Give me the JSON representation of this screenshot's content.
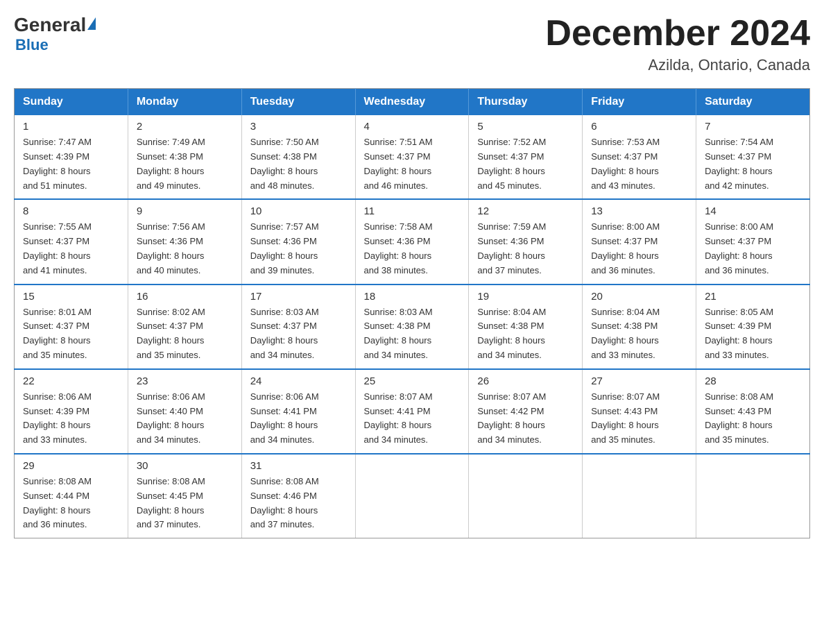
{
  "logo": {
    "general": "General",
    "blue": "Blue",
    "subtitle": "Blue"
  },
  "title": {
    "month_year": "December 2024",
    "location": "Azilda, Ontario, Canada"
  },
  "headers": [
    "Sunday",
    "Monday",
    "Tuesday",
    "Wednesday",
    "Thursday",
    "Friday",
    "Saturday"
  ],
  "weeks": [
    [
      {
        "day": "1",
        "sunrise": "7:47 AM",
        "sunset": "4:39 PM",
        "daylight": "8 hours and 51 minutes."
      },
      {
        "day": "2",
        "sunrise": "7:49 AM",
        "sunset": "4:38 PM",
        "daylight": "8 hours and 49 minutes."
      },
      {
        "day": "3",
        "sunrise": "7:50 AM",
        "sunset": "4:38 PM",
        "daylight": "8 hours and 48 minutes."
      },
      {
        "day": "4",
        "sunrise": "7:51 AM",
        "sunset": "4:37 PM",
        "daylight": "8 hours and 46 minutes."
      },
      {
        "day": "5",
        "sunrise": "7:52 AM",
        "sunset": "4:37 PM",
        "daylight": "8 hours and 45 minutes."
      },
      {
        "day": "6",
        "sunrise": "7:53 AM",
        "sunset": "4:37 PM",
        "daylight": "8 hours and 43 minutes."
      },
      {
        "day": "7",
        "sunrise": "7:54 AM",
        "sunset": "4:37 PM",
        "daylight": "8 hours and 42 minutes."
      }
    ],
    [
      {
        "day": "8",
        "sunrise": "7:55 AM",
        "sunset": "4:37 PM",
        "daylight": "8 hours and 41 minutes."
      },
      {
        "day": "9",
        "sunrise": "7:56 AM",
        "sunset": "4:36 PM",
        "daylight": "8 hours and 40 minutes."
      },
      {
        "day": "10",
        "sunrise": "7:57 AM",
        "sunset": "4:36 PM",
        "daylight": "8 hours and 39 minutes."
      },
      {
        "day": "11",
        "sunrise": "7:58 AM",
        "sunset": "4:36 PM",
        "daylight": "8 hours and 38 minutes."
      },
      {
        "day": "12",
        "sunrise": "7:59 AM",
        "sunset": "4:36 PM",
        "daylight": "8 hours and 37 minutes."
      },
      {
        "day": "13",
        "sunrise": "8:00 AM",
        "sunset": "4:37 PM",
        "daylight": "8 hours and 36 minutes."
      },
      {
        "day": "14",
        "sunrise": "8:00 AM",
        "sunset": "4:37 PM",
        "daylight": "8 hours and 36 minutes."
      }
    ],
    [
      {
        "day": "15",
        "sunrise": "8:01 AM",
        "sunset": "4:37 PM",
        "daylight": "8 hours and 35 minutes."
      },
      {
        "day": "16",
        "sunrise": "8:02 AM",
        "sunset": "4:37 PM",
        "daylight": "8 hours and 35 minutes."
      },
      {
        "day": "17",
        "sunrise": "8:03 AM",
        "sunset": "4:37 PM",
        "daylight": "8 hours and 34 minutes."
      },
      {
        "day": "18",
        "sunrise": "8:03 AM",
        "sunset": "4:38 PM",
        "daylight": "8 hours and 34 minutes."
      },
      {
        "day": "19",
        "sunrise": "8:04 AM",
        "sunset": "4:38 PM",
        "daylight": "8 hours and 34 minutes."
      },
      {
        "day": "20",
        "sunrise": "8:04 AM",
        "sunset": "4:38 PM",
        "daylight": "8 hours and 33 minutes."
      },
      {
        "day": "21",
        "sunrise": "8:05 AM",
        "sunset": "4:39 PM",
        "daylight": "8 hours and 33 minutes."
      }
    ],
    [
      {
        "day": "22",
        "sunrise": "8:06 AM",
        "sunset": "4:39 PM",
        "daylight": "8 hours and 33 minutes."
      },
      {
        "day": "23",
        "sunrise": "8:06 AM",
        "sunset": "4:40 PM",
        "daylight": "8 hours and 34 minutes."
      },
      {
        "day": "24",
        "sunrise": "8:06 AM",
        "sunset": "4:41 PM",
        "daylight": "8 hours and 34 minutes."
      },
      {
        "day": "25",
        "sunrise": "8:07 AM",
        "sunset": "4:41 PM",
        "daylight": "8 hours and 34 minutes."
      },
      {
        "day": "26",
        "sunrise": "8:07 AM",
        "sunset": "4:42 PM",
        "daylight": "8 hours and 34 minutes."
      },
      {
        "day": "27",
        "sunrise": "8:07 AM",
        "sunset": "4:43 PM",
        "daylight": "8 hours and 35 minutes."
      },
      {
        "day": "28",
        "sunrise": "8:08 AM",
        "sunset": "4:43 PM",
        "daylight": "8 hours and 35 minutes."
      }
    ],
    [
      {
        "day": "29",
        "sunrise": "8:08 AM",
        "sunset": "4:44 PM",
        "daylight": "8 hours and 36 minutes."
      },
      {
        "day": "30",
        "sunrise": "8:08 AM",
        "sunset": "4:45 PM",
        "daylight": "8 hours and 37 minutes."
      },
      {
        "day": "31",
        "sunrise": "8:08 AM",
        "sunset": "4:46 PM",
        "daylight": "8 hours and 37 minutes."
      },
      null,
      null,
      null,
      null
    ]
  ],
  "labels": {
    "sunrise": "Sunrise:",
    "sunset": "Sunset:",
    "daylight": "Daylight:"
  }
}
